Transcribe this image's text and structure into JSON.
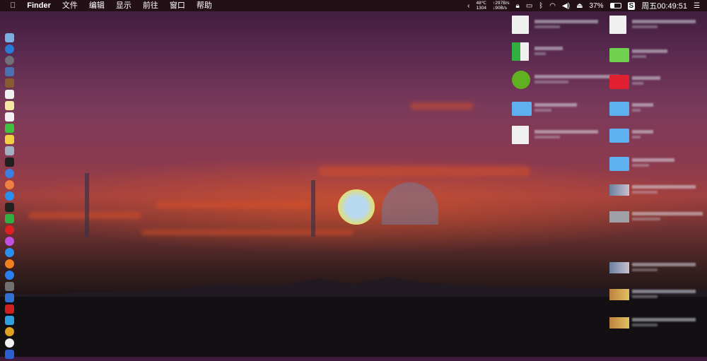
{
  "menubar": {
    "apple_icon": "apple-logo",
    "app_name": "Finder",
    "menus": [
      "文件",
      "编辑",
      "显示",
      "前往",
      "窗口",
      "帮助"
    ],
    "status": {
      "temperature": "48℃",
      "fan": "1304",
      "upload": "↑297B/s",
      "download": "↓90B/s",
      "battery": "37%",
      "clock": "周五00:49:51"
    }
  },
  "dock": {
    "items": [
      "finder",
      "safari",
      "launchpad",
      "preview",
      "notebook",
      "calendar",
      "notes",
      "reminders",
      "wechat",
      "stickies",
      "photo-viewer",
      "terminal",
      "siri",
      "photos",
      "messages",
      "calculator",
      "facetime",
      "netease-music",
      "itunes",
      "qq-browser",
      "ibooks",
      "app-store",
      "system-preferences",
      "contacts",
      "flash-player",
      "migration-assistant",
      "chrome",
      "crown-app",
      "xcode"
    ]
  },
  "colors": {
    "menubar": "#1e0e10",
    "folder": "#5fb0ee"
  }
}
